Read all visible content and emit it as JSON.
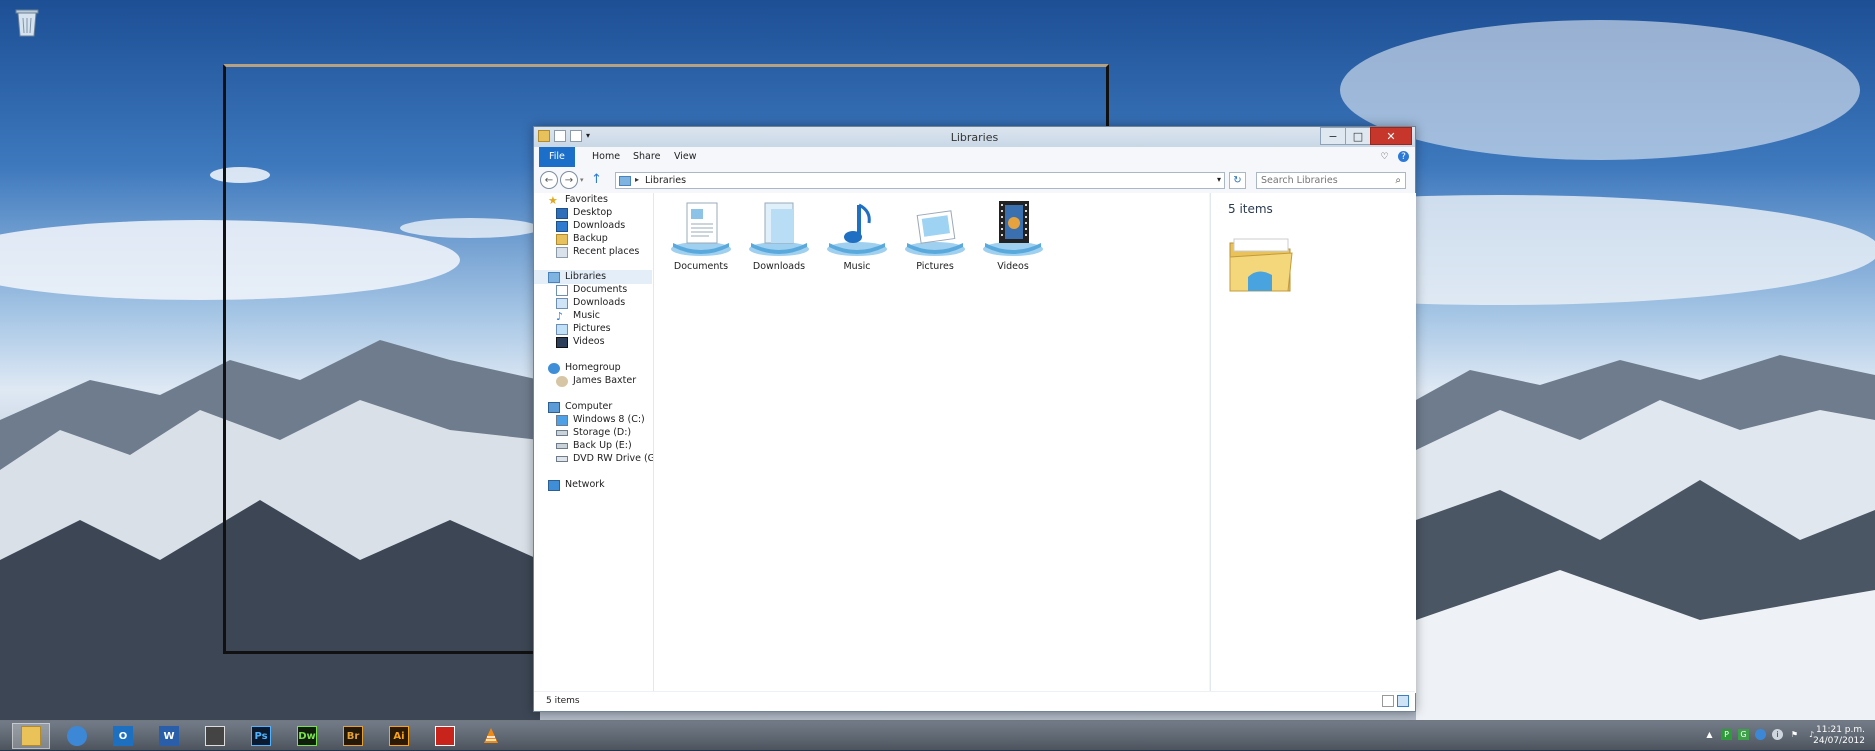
{
  "window": {
    "title": "Libraries",
    "minimize": "−",
    "maximize": "□",
    "close": "✕"
  },
  "ribbon": {
    "tabs": [
      "File",
      "Home",
      "Share",
      "View"
    ]
  },
  "address": {
    "path": "Libraries",
    "search_placeholder": "Search Libraries"
  },
  "nav": {
    "favorites": {
      "label": "Favorites",
      "items": [
        "Desktop",
        "Downloads",
        "Backup",
        "Recent places"
      ]
    },
    "libraries": {
      "label": "Libraries",
      "items": [
        "Documents",
        "Downloads",
        "Music",
        "Pictures",
        "Videos"
      ]
    },
    "homegroup": {
      "label": "Homegroup",
      "items": [
        "James Baxter"
      ]
    },
    "computer": {
      "label": "Computer",
      "items": [
        "Windows 8 (C:)",
        "Storage (D:)",
        "Back Up (E:)",
        "DVD RW Drive (G:) H"
      ]
    },
    "network": {
      "label": "Network"
    }
  },
  "libraries": [
    {
      "label": "Documents",
      "icon": "documents-library-icon"
    },
    {
      "label": "Downloads",
      "icon": "downloads-library-icon"
    },
    {
      "label": "Music",
      "icon": "music-library-icon"
    },
    {
      "label": "Pictures",
      "icon": "pictures-library-icon"
    },
    {
      "label": "Videos",
      "icon": "videos-library-icon"
    }
  ],
  "preview": {
    "count": "5 items"
  },
  "status": {
    "items": "5 items"
  },
  "taskbar": {
    "apps": [
      {
        "name": "file-explorer",
        "text": ""
      },
      {
        "name": "internet-explorer",
        "text": ""
      },
      {
        "name": "outlook",
        "text": "O"
      },
      {
        "name": "word",
        "text": "W"
      },
      {
        "name": "movie-maker",
        "text": ""
      },
      {
        "name": "photoshop",
        "text": "Ps"
      },
      {
        "name": "dreamweaver",
        "text": "Dw"
      },
      {
        "name": "bridge",
        "text": "Br"
      },
      {
        "name": "illustrator",
        "text": "Ai"
      },
      {
        "name": "acrobat",
        "text": ""
      },
      {
        "name": "vlc",
        "text": ""
      }
    ],
    "clock_time": "11:21 p.m.",
    "clock_date": "24/07/2012"
  },
  "colors": {
    "accent": "#1c6fc9",
    "close": "#c7362b"
  }
}
